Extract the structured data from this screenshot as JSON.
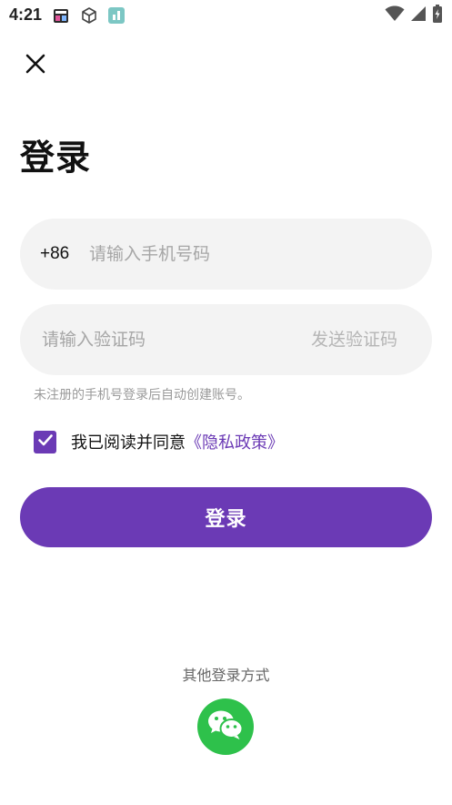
{
  "status_bar": {
    "time": "4:21",
    "icons": [
      "sim-card-notification-icon",
      "cube-notification-icon",
      "app-notification-icon",
      "wifi-icon",
      "cellular-signal-icon",
      "battery-charging-icon"
    ]
  },
  "header": {
    "close_icon": "close-icon",
    "title": "登录"
  },
  "phone": {
    "country_code": "+86",
    "placeholder": "请输入手机号码",
    "value": ""
  },
  "code": {
    "placeholder": "请输入验证码",
    "value": "",
    "send_label": "发送验证码"
  },
  "hint": "未注册的手机号登录后自动创建账号。",
  "agreement": {
    "checked": true,
    "text": "我已阅读并同意",
    "link": "《隐私政策》"
  },
  "login_button": "登录",
  "other_login": {
    "title": "其他登录方式",
    "wechat_icon": "wechat-icon"
  },
  "colors": {
    "accent": "#6b3ab5",
    "input_bg": "#f3f3f3",
    "wechat": "#2ec14b"
  }
}
